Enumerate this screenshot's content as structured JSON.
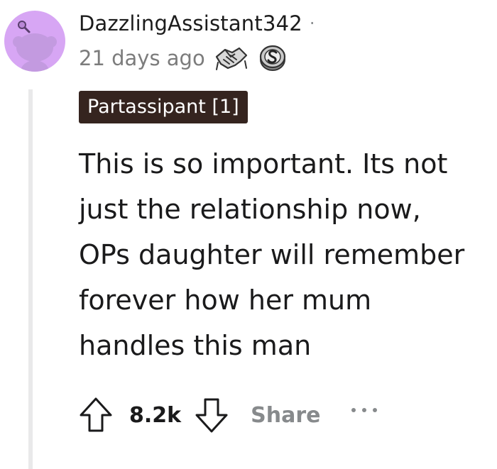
{
  "comment": {
    "username": "DazzlingAssistant342",
    "separator": "·",
    "timestamp": "21 days ago",
    "awards": [
      "handshake-award-icon",
      "silver-award-icon"
    ],
    "flair": "Partassipant [1]",
    "body_lines": [
      "This is so important. Its not",
      "just the relationship now,",
      "OPs daughter will remember",
      "forever how her mum",
      "handles this man"
    ],
    "vote_count": "8.2k",
    "share_label": "Share"
  },
  "colors": {
    "avatar_bg": "#d7a6f4",
    "flair_bg": "#35241f",
    "muted_text": "#878a8c",
    "thread_line": "#e9e9ea"
  }
}
